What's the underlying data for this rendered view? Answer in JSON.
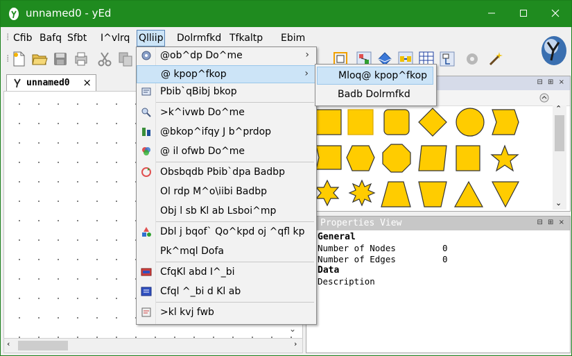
{
  "window": {
    "title": "unnamed0 - yEd"
  },
  "colors": {
    "titlebar": "#1f8b1f",
    "shape_fill": "#ffcc00",
    "shape_stroke": "#333333",
    "highlight": "#cce4f7"
  },
  "menubar": {
    "items": [
      {
        "label": "Cfib"
      },
      {
        "label": "Bafq"
      },
      {
        "label": "Sfbt"
      },
      {
        "label": "I^vlrq"
      },
      {
        "label": "Qlli"
      },
      {
        "label": "ip"
      },
      {
        "label": "Dolrmfkd"
      },
      {
        "label": "Tfkaltp"
      },
      {
        "label": "Ebim"
      }
    ]
  },
  "tab": {
    "label": "unnamed0",
    "close": "×"
  },
  "palette": {
    "header_buttons": "⊟ ⊞ ×",
    "collapse_icon": "chevron-up-icon"
  },
  "properties": {
    "title": "Properties View",
    "header_buttons": "⊟ ⊞ ×",
    "sections": [
      {
        "name": "General",
        "rows": [
          {
            "key": "Number of Nodes",
            "value": "0"
          },
          {
            "key": "Number of Edges",
            "value": "0"
          }
        ]
      },
      {
        "name": "Data",
        "rows": [
          {
            "key": "Description",
            "value": ""
          }
        ]
      }
    ]
  },
  "dropdown": {
    "items": [
      {
        "label": "@ob^dp Do^me",
        "icon": "gear-icon",
        "submenu": true
      },
      {
        "label": "@ kpop^fkop",
        "icon": "none",
        "submenu": true,
        "highlighted": true
      },
      {
        "label": "Pbib`qBibj bkop",
        "icon": "select-icon"
      },
      {
        "label": ">k^ivwb Do^me",
        "icon": "analyze-icon"
      },
      {
        "label": "@bkop^ifqy J b^prdop",
        "icon": "measure-icon"
      },
      {
        "label": "@ il ofwb Do^me",
        "icon": "color-icon"
      },
      {
        "label": "Obsbqdb Pbib`dpa Badbp",
        "icon": "reverse-icon"
      },
      {
        "label": "Ol rdp M^o\\iibi Badbp",
        "icon": "none"
      },
      {
        "label": "Obj l sb Kl ab Lsboi^mp",
        "icon": "none"
      },
      {
        "label": "Dbl j bqof` Qo^kpd oj ^qfl kp",
        "icon": "transform-icon"
      },
      {
        "label": "Pk^mql Dofa",
        "icon": "none"
      },
      {
        "label": "CfqKl abd I^_bi",
        "icon": "fit-label-icon"
      },
      {
        "label": "Cfql ^_bi d Kl ab",
        "icon": "fit-node-icon"
      },
      {
        "label": ">kl kvj fwb",
        "icon": "anonymize-icon"
      }
    ]
  },
  "submenu": {
    "items": [
      {
        "label": "Mloq@ kpop^fkop",
        "highlighted": true
      },
      {
        "label": "Badb Dolrmfkd"
      }
    ]
  }
}
